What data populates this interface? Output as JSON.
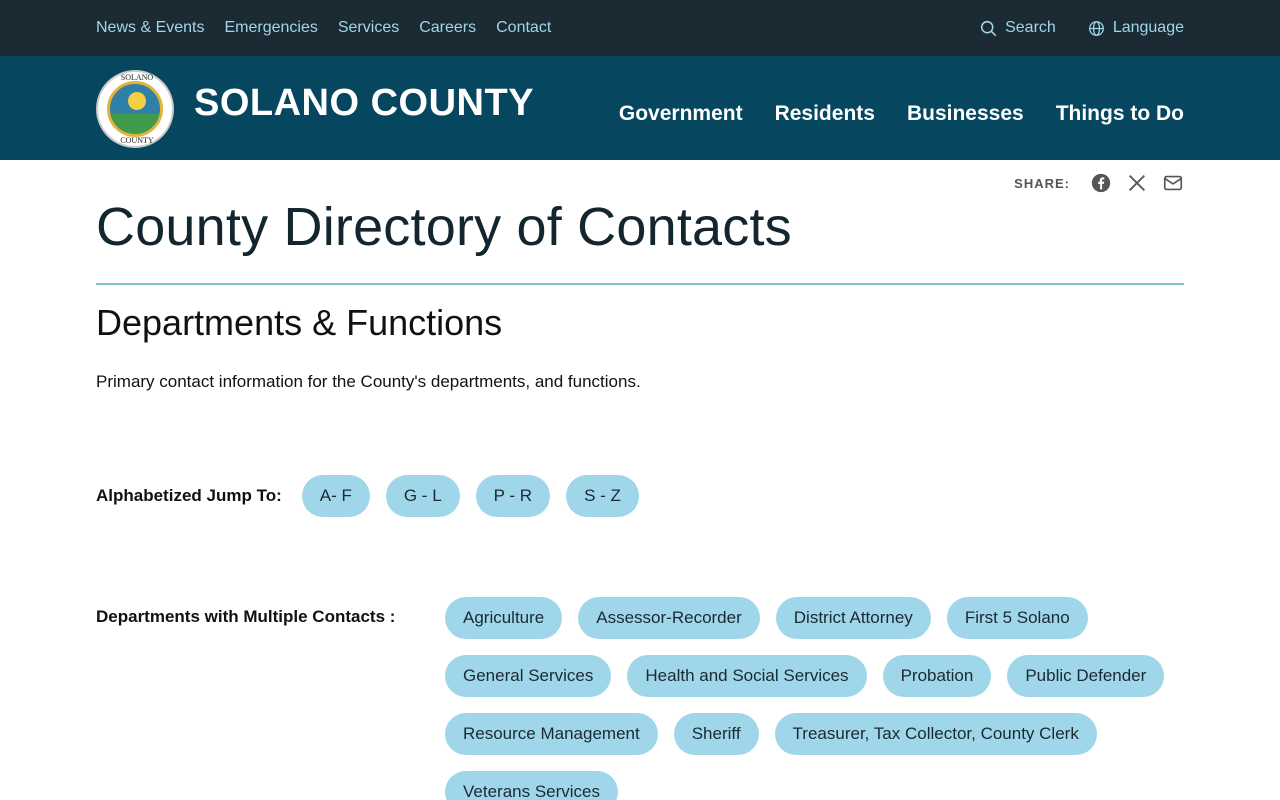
{
  "top_nav": {
    "links": [
      "News & Events",
      "Emergencies",
      "Services",
      "Careers",
      "Contact"
    ],
    "search_label": "Search",
    "language_label": "Language"
  },
  "header": {
    "seal_text_top": "SOLANO",
    "seal_text_bottom": "COUNTY",
    "site_name": "SOLANO COUNTY",
    "nav": [
      "Government",
      "Residents",
      "Businesses",
      "Things to Do"
    ]
  },
  "share": {
    "label": "SHARE:",
    "icons": [
      "facebook-icon",
      "x-icon",
      "email-icon"
    ]
  },
  "page": {
    "title": "County Directory of Contacts",
    "section_title": "Departments & Functions",
    "intro": "Primary contact information for the County's departments, and functions."
  },
  "jump": {
    "label": "Alphabetized Jump To:",
    "options": [
      "A- F",
      "G - L",
      "P - R",
      "S - Z"
    ]
  },
  "departments": {
    "label": "Departments with Multiple Contacts :",
    "items": [
      "Agriculture",
      "Assessor-Recorder",
      "District Attorney",
      "First 5 Solano",
      "General Services",
      "Health and Social Services",
      "Probation",
      "Public Defender",
      "Resource Management",
      "Sheriff",
      "Treasurer, Tax Collector, County Clerk",
      "Veterans Services"
    ]
  },
  "colors": {
    "topbar": "#1b2a33",
    "mainbar": "#06475f",
    "pill": "#9fd6ea",
    "divider": "#7cc3cc"
  }
}
